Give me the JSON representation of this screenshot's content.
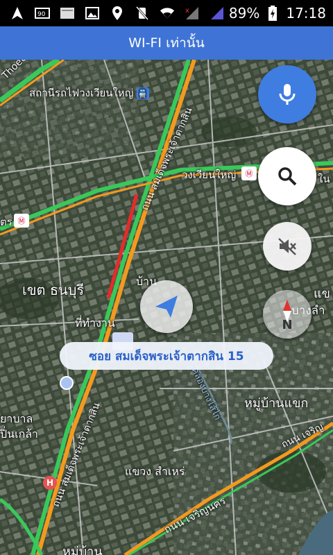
{
  "status_bar": {
    "battery_percent": "89%",
    "time": "17:18",
    "icons": [
      "navigation-icon",
      "notification-90-icon",
      "storage-icon",
      "image-icon",
      "location-icon",
      "vibrate-off-icon",
      "wifi-icon",
      "signal-no-data-icon",
      "signal-icon",
      "battery-charging-icon"
    ]
  },
  "top_banner": {
    "text": "WI-FI เท่านั้น"
  },
  "map": {
    "labels": {
      "station": "สถานีรถไฟวงเวียนใหญ่",
      "road_thoet_thai": "Thoet Thai",
      "taksin_road_top": "ถนน สมเด็จพระเจ้าตากสิน",
      "wongwian_yai": "วงเวียนใหญ่",
      "district_thonburi": "เขต ธนบุรี",
      "ban": "บ้าน",
      "tha_kan": "ที่ทำงาน",
      "right_edge_top": "ใน",
      "right_edge_mid": "แข",
      "right_edge_mid2": "บางลำ",
      "village_khaek": "หมู่บ้านแขก",
      "hospital": "ยาบาล",
      "pin_klao": "ปิ่นเกล้า",
      "taksin_road_lower": "ถนน สมเด็จพระเจ้าตากสิน",
      "khlong_label": "คลองบางไส้ไก่",
      "khwaeng_samre": "แขวง สำเหร่",
      "charoen_nakhon": "ถนน เจริญนคร",
      "charoen_right": "ถนน เจริญ",
      "village_bottom": "หมู่บ้าน",
      "left_edge_tr": "ตร"
    },
    "current_street": "ซอย สมเด็จพระเจ้าตากสิน 15"
  },
  "controls": {
    "compass_letter": "N",
    "hospital_letter": "H"
  },
  "colors": {
    "accent_blue": "#3f74d6",
    "mic_blue": "#3f7de0",
    "traffic_green": "#39c95a",
    "traffic_orange": "#f39a1e",
    "traffic_red": "#e52b2b"
  }
}
